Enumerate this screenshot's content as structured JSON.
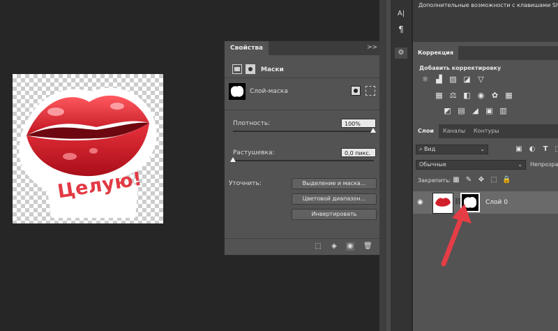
{
  "canvas": {
    "sticker_text": "Целую!"
  },
  "properties": {
    "tab": "Свойства",
    "menu_collapse": ">>",
    "section": "Маски",
    "mask_type": "Слой-маска",
    "density_label": "Плотность:",
    "density_value": "100%",
    "feather_label": "Растушевка:",
    "feather_value": "0,0 пикс.",
    "refine_label": "Уточнить:",
    "buttons": [
      "Выделение и маска...",
      "Цветовой диапазон...",
      "Инвертировать"
    ]
  },
  "tips": {
    "line1": "Дополнительные возможности с клавишами Shift, А"
  },
  "tools": {
    "text_tool": "A|",
    "paragraph_tool": "¶"
  },
  "adjustments": {
    "tab": "Коррекция",
    "title": "Добавить корректировку"
  },
  "layers": {
    "tabs": [
      "Слои",
      "Каналы",
      "Контуры"
    ],
    "filter": "Вид",
    "blend_mode": "Обычные",
    "opacity_label": "Непрозрачн",
    "lock_label": "Закрепить:",
    "layer_name": "Слой 0"
  },
  "colors": {
    "accent_arrow": "#e53d46",
    "lips": "#d11f2a",
    "panel_bg": "#535353"
  }
}
